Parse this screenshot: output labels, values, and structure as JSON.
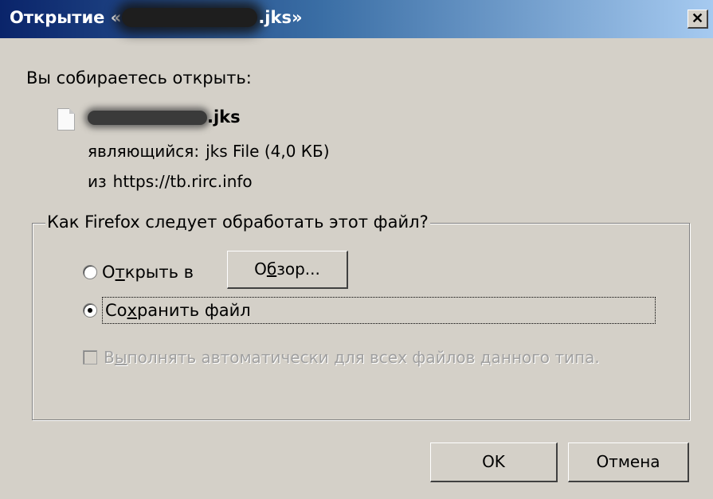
{
  "window": {
    "title_prefix": "Открытие «",
    "title_suffix": ".jks»",
    "close_glyph": "✕"
  },
  "intro": "Вы собираетесь открыть:",
  "file": {
    "icon": "document-icon",
    "name_suffix": ".jks",
    "type_label": "являющийся:",
    "type_value": "jks File (4,0 КБ)",
    "source_label": "из",
    "source_value": "https://tb.rirc.info"
  },
  "action_group": {
    "legend": "Как Firefox следует обработать этот файл?",
    "open_with": {
      "label_pre": "О",
      "label_access": "т",
      "label_post": "крыть в",
      "checked": false
    },
    "browse_button": {
      "label_pre": "О",
      "label_access": "б",
      "label_post": "зор..."
    },
    "save_file": {
      "label_pre": "Со",
      "label_access": "х",
      "label_post": "ранить файл",
      "checked": true
    },
    "auto_checkbox": {
      "label_pre": "В",
      "label_access": "ы",
      "label_post": "полнять автоматически для всех файлов данного типа.",
      "checked": false,
      "enabled": false
    }
  },
  "buttons": {
    "ok": "OK",
    "cancel": "Отмена"
  }
}
